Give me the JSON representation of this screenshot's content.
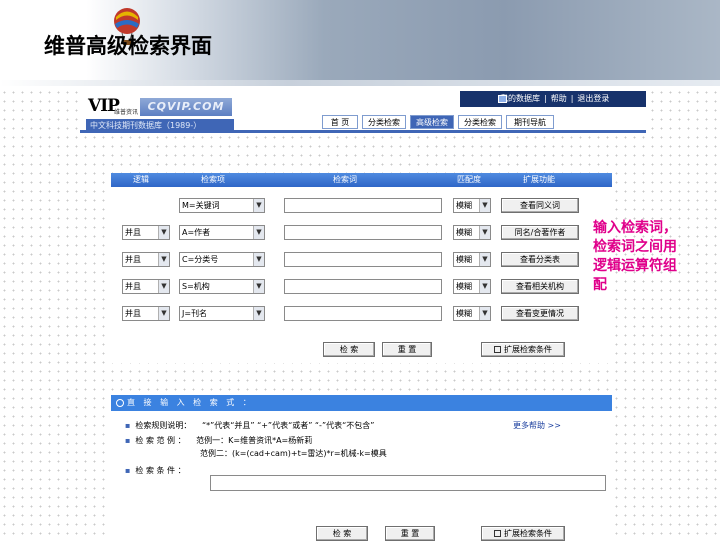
{
  "slide": {
    "title": "维普高级检索界面"
  },
  "callout": "输入检索词，检索词之间用逻辑运算符组配",
  "site": {
    "logo_text": "VIP",
    "logo_subtext": "维普资讯",
    "logo_url": "CQVIP.COM",
    "sub_banner": "中文科技期刊数据库（1989-）",
    "toplinks": [
      "我的数据库",
      "帮助",
      "退出登录"
    ],
    "nav_tabs": [
      {
        "label": "首 页",
        "active": false
      },
      {
        "label": "分类检索",
        "active": false
      },
      {
        "label": "高级检索",
        "active": true
      },
      {
        "label": "分类检索",
        "active": false
      },
      {
        "label": "期刊导航",
        "active": false
      }
    ]
  },
  "search_panel": {
    "headers": [
      "逻辑",
      "检索项",
      "检索词",
      "匹配度",
      "扩展功能"
    ],
    "rows": [
      {
        "logic": "",
        "field": "M=关键词",
        "term": "",
        "match": "模糊",
        "ext": "查看同义词"
      },
      {
        "logic": "并且",
        "field": "A=作者",
        "term": "",
        "match": "模糊",
        "ext": "同名/合著作者"
      },
      {
        "logic": "并且",
        "field": "C=分类号",
        "term": "",
        "match": "模糊",
        "ext": "查看分类表"
      },
      {
        "logic": "并且",
        "field": "S=机构",
        "term": "",
        "match": "模糊",
        "ext": "查看相关机构"
      },
      {
        "logic": "并且",
        "field": "J=刊名",
        "term": "",
        "match": "模糊",
        "ext": "查看变更情况"
      }
    ],
    "buttons": {
      "search": "检 索",
      "reset": "重 置",
      "expand": "扩展检索条件"
    }
  },
  "direct_panel": {
    "header": "直 接 输 入 检 索 式 ：",
    "desc_label": "检索规则说明：",
    "desc_text": "“*”代表“并且”  “+”代表“或者”  “-”代表“不包含”",
    "more_help": "更多帮助 >>",
    "example_label": "检 索 范 例 ：",
    "example1": "范例一：K=维普资讯*A=杨新莉",
    "example2": "范例二：(k=(cad+cam)+t=雷达)*r=机械-k=模具",
    "condition_label": "检 索 条 件 ：",
    "condition_value": "",
    "buttons": {
      "search": "检 索",
      "reset": "重 置",
      "expand": "扩展检索条件"
    }
  }
}
